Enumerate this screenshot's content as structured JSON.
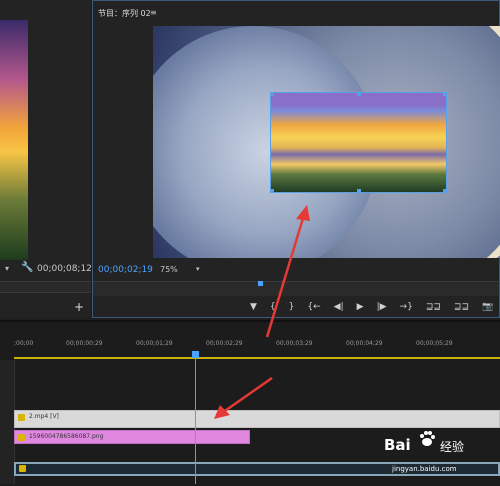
{
  "source_monitor": {
    "dropdown_icon": "chevron-down-icon",
    "wrench_icon": "wrench-icon",
    "timecode": "00;00;08;12",
    "add_label": "+"
  },
  "program_monitor": {
    "tab_label": "节目：序列 02",
    "menu_label": "≡",
    "timecode": "00;00;02;19",
    "zoom": "75%",
    "transport": [
      "▼",
      "{",
      "}",
      "{←",
      "◀|",
      "▶",
      "|▶",
      "→}",
      "⊒⊒",
      "⊒⊒",
      "📷"
    ]
  },
  "timeline": {
    "ruler_ticks": [
      ";00;00",
      "00;00;00;29",
      "00;00;01;29",
      "00;00;02;29",
      "00;00;03;29",
      "00;00;04;29",
      "00;00;05;29"
    ],
    "clips": {
      "video": "2.mp4 [V]",
      "image": "1596004786586087.png"
    }
  },
  "colors": {
    "accent": "#4aa3ff",
    "ruler_line": "#c9b200",
    "image_clip": "#e088e0",
    "arrow": "#e53935"
  },
  "watermark": {
    "brand": "Bai",
    "text": "经验",
    "url": "jingyan.baidu.com"
  }
}
